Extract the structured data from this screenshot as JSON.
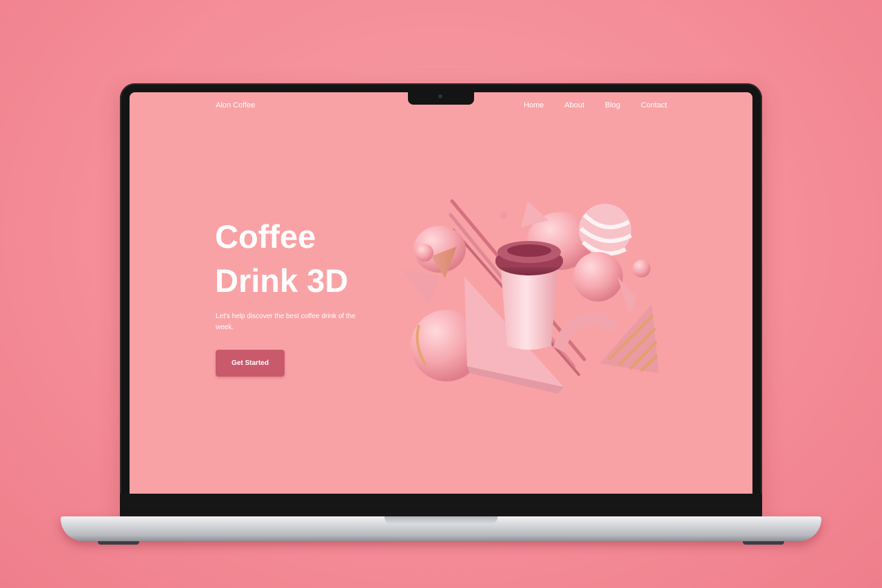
{
  "site": {
    "brand": "Alon Coffee",
    "nav": [
      "Home",
      "About",
      "Blog",
      "Contact"
    ]
  },
  "hero": {
    "title_line1": "Coffee",
    "title_line2": "Drink 3D",
    "subtitle": "Let's help discover the best coffee drink of the week.",
    "cta_label": "Get Started",
    "illustration_icon": "3d-coffee-cup-shapes-illustration"
  },
  "colors": {
    "background": "#f48e98",
    "screen": "#f9a2a5",
    "cta": "#c85a6c",
    "text": "#ffffff"
  }
}
